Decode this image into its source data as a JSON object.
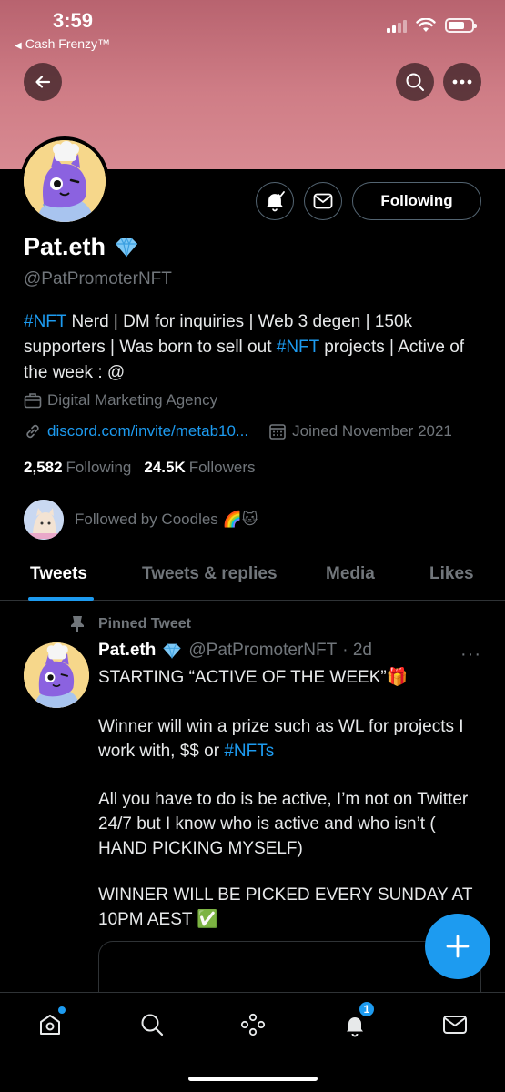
{
  "status_bar": {
    "time": "3:59",
    "back_app": "Cash Frenzy™"
  },
  "profile": {
    "name": "Pat.eth",
    "handle": "@PatPromoterNFT",
    "following_button": "Following",
    "bio": {
      "part1_tag": "#NFT",
      "part2": " Nerd | DM for inquiries | Web 3 degen | 150k supporters | Was born to sell out ",
      "part3_tag": "#NFT",
      "part4": " projects | Active of the week : @"
    },
    "category": "Digital Marketing Agency",
    "link": "discord.com/invite/metab10...",
    "joined": "Joined November 2021",
    "following_count": "2,582",
    "following_label": "Following",
    "followers_count": "24.5K",
    "followers_label": "Followers",
    "followed_by": "Followed by Coodles 🌈🐱"
  },
  "tabs": [
    {
      "label": "Tweets",
      "active": true
    },
    {
      "label": "Tweets & replies",
      "active": false
    },
    {
      "label": "Media",
      "active": false
    },
    {
      "label": "Likes",
      "active": false
    }
  ],
  "tweet": {
    "pinned_label": "Pinned Tweet",
    "author_name": "Pat.eth",
    "author_handle": "@PatPromoterNFT",
    "time": "· 2d",
    "more": "···",
    "para1": "STARTING “ACTIVE OF THE WEEK”🎁",
    "para2_text": "Winner will win a prize such as WL for projects I work with, $$ or ",
    "para2_tag": "#NFTs",
    "para3": "All you have to do is be active, I’m not on Twitter 24/7 but I know who is active and who isn’t ( HAND PICKING MYSELF)",
    "para4": "WINNER WILL BE PICKED EVERY SUNDAY AT 10PM AEST ✅"
  },
  "bottom_nav": {
    "notifications_badge": "1"
  },
  "colors": {
    "accent": "#1d9bf0",
    "banner": "#cf7d86",
    "background": "#000000",
    "muted": "#71767b"
  },
  "icons": [
    "back-arrow-icon",
    "search-icon",
    "more-icon",
    "notification-bell-icon",
    "mail-icon",
    "verified-diamond-icon",
    "briefcase-icon",
    "link-icon",
    "calendar-icon",
    "pin-icon",
    "compose-plus-icon",
    "home-icon",
    "explore-icon",
    "spaces-icon",
    "wifi-icon",
    "signal-icon",
    "battery-icon"
  ]
}
